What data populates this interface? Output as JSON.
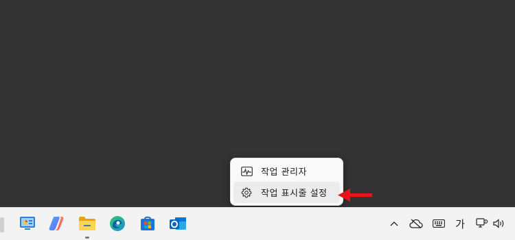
{
  "context_menu": {
    "items": [
      {
        "label": "작업 관리자",
        "icon": "task-manager-icon"
      },
      {
        "label": "작업 표시줄 설정",
        "icon": "gear-icon"
      }
    ]
  },
  "annotation": {
    "color": "#e8141b",
    "icon": "red-arrow-left"
  },
  "taskbar": {
    "apps": [
      {
        "name": "control-panel-icon"
      },
      {
        "name": "copilot-icon"
      },
      {
        "name": "file-explorer-icon",
        "active": true
      },
      {
        "name": "edge-icon"
      },
      {
        "name": "microsoft-store-icon"
      },
      {
        "name": "outlook-icon"
      }
    ],
    "tray": {
      "ime_label": "가"
    }
  }
}
